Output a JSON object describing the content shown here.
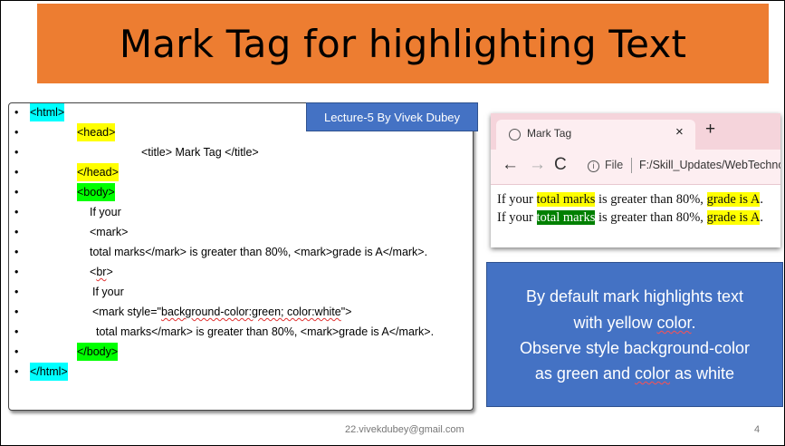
{
  "slide": {
    "title": "Mark Tag for highlighting Text",
    "lecture_badge": "Lecture-5 By Vivek Dubey",
    "footer_email": "22.vivekdubey@gmail.com",
    "page_number": "4",
    "colors": {
      "banner": "#ed7d31",
      "panel": "#4472c4",
      "cyan": "#00ffff",
      "yellow": "#ffff00",
      "green": "#00ff00"
    }
  },
  "code": {
    "bullet": "•",
    "lines": [
      "<html>",
      "<head>",
      "<title> Mark Tag </title>",
      "</head>",
      "<body>",
      "If your",
      "<mark>",
      "total marks</mark> is greater than 80%, <mark>grade is A</mark>.",
      "<",
      "br",
      ">",
      "If your",
      "<mark style=\"",
      "background-color:green; color:white",
      "\">",
      "total marks</mark> is greater than 80%, <mark>grade is A</mark>.",
      "</body>",
      "</html>"
    ]
  },
  "browser": {
    "tab_title": "Mark Tag",
    "tab_close": "×",
    "new_tab": "+",
    "back": "←",
    "forward": "→",
    "reload": "C",
    "info": "i",
    "file_label": "File",
    "url": "F:/Skill_Updates/WebTechno",
    "render": {
      "l1_a": "If your ",
      "l1_b": "total marks",
      "l1_c": " is greater than 80%, ",
      "l1_d": "grade is A",
      "l1_e": ".",
      "l2_a": "If your ",
      "l2_b": "total marks",
      "l2_c": " is greater than 80%, ",
      "l2_d": "grade is A",
      "l2_e": "."
    }
  },
  "panel": {
    "l1": "By default mark highlights text",
    "l2_a": "with yellow ",
    "l2_b": "color",
    "l2_c": ".",
    "l3": "Observe style background-color",
    "l4_a": "as green and ",
    "l4_b": "color",
    "l4_c": " as white"
  }
}
